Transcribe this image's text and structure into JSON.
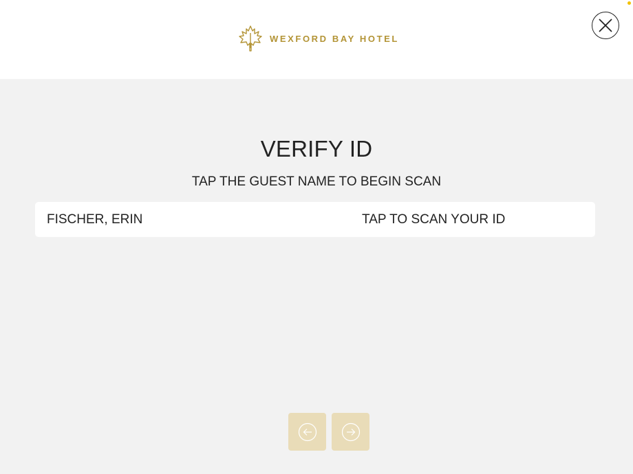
{
  "header": {
    "brand_name": "WEXFORD BAY HOTEL",
    "logo_icon": "maple-leaf-icon",
    "close_icon": "close-icon"
  },
  "main": {
    "title": "VERIFY ID",
    "subtitle": "TAP THE GUEST NAME TO BEGIN SCAN",
    "guests": [
      {
        "name": "FISCHER, ERIN",
        "action": "TAP TO SCAN YOUR ID"
      }
    ]
  },
  "pagination": {
    "prev_icon": "arrow-left-circle-icon",
    "next_icon": "arrow-right-circle-icon"
  },
  "colors": {
    "brand_gold": "#b39436",
    "nav_button_bg": "#e9dcb8",
    "page_bg": "#f2f2f2",
    "header_bg": "#ffffff",
    "status_dot": "#f2c200"
  }
}
